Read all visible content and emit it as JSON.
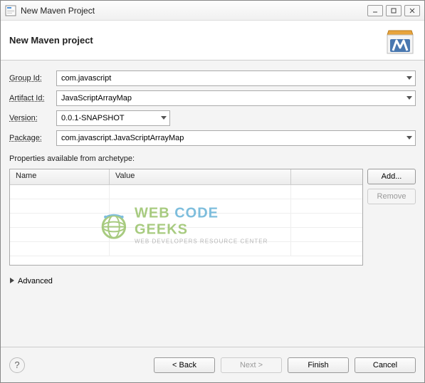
{
  "window": {
    "title": "New Maven Project"
  },
  "header": {
    "title": "New Maven project"
  },
  "form": {
    "groupId": {
      "label": "Group Id:",
      "value": "com.javascript"
    },
    "artifactId": {
      "label": "Artifact Id:",
      "value": "JavaScriptArrayMap"
    },
    "version": {
      "label": "Version:",
      "value": "0.0.1-SNAPSHOT"
    },
    "package": {
      "label": "Package:",
      "value": "com.javascript.JavaScriptArrayMap"
    }
  },
  "properties": {
    "label": "Properties available from archetype:",
    "columns": {
      "name": "Name",
      "value": "Value"
    },
    "rows": []
  },
  "buttons": {
    "add": "Add...",
    "remove": "Remove",
    "advanced": "Advanced",
    "back": "< Back",
    "next": "Next >",
    "finish": "Finish",
    "cancel": "Cancel"
  },
  "watermark": {
    "title1": "WEB",
    "title2": "CODE",
    "title3": "GEEKS",
    "sub": "WEB DEVELOPERS RESOURCE CENTER"
  }
}
